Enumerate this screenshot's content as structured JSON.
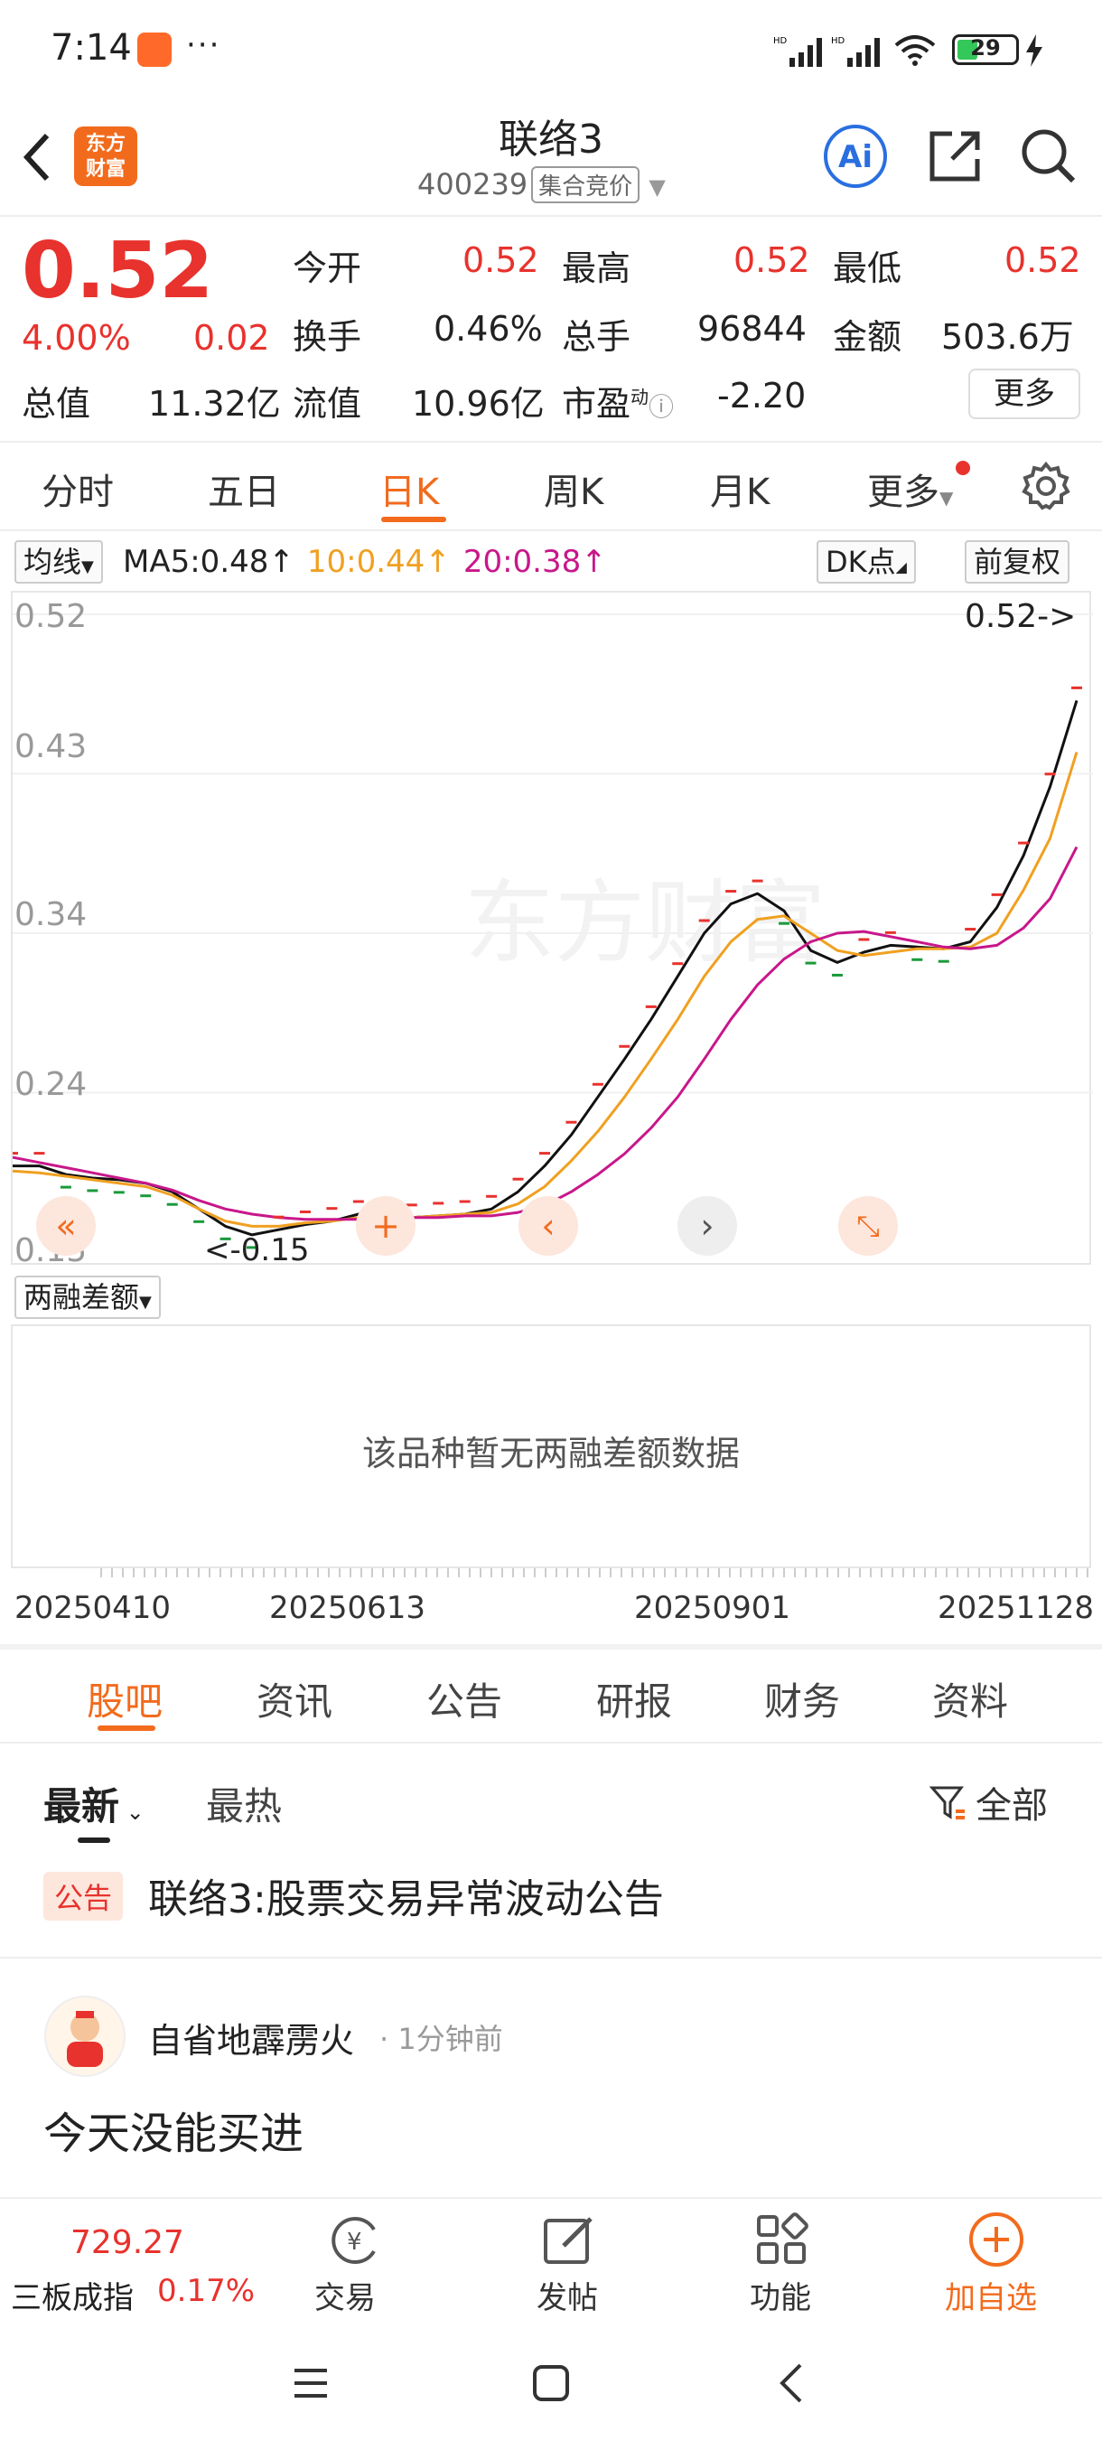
{
  "status": {
    "time": "7:14",
    "battery": "29"
  },
  "header": {
    "back": "‹",
    "logo_line1": "东方",
    "logo_line2": "财富",
    "title": "联络3",
    "code": "400239",
    "badge": "集合竞价"
  },
  "quote": {
    "price": "0.52",
    "change_pct": "4.00%",
    "change": "0.02",
    "open_label": "今开",
    "open": "0.52",
    "high_label": "最高",
    "high": "0.52",
    "low_label": "最低",
    "low": "0.52",
    "turnover_label": "换手",
    "turnover": "0.46%",
    "volume_label": "总手",
    "volume": "96844",
    "amount_label": "金额",
    "amount": "503.6万",
    "mcap_label": "总值",
    "mcap": "11.32亿",
    "float_label": "流值",
    "float": "10.96亿",
    "pe_label": "市盈",
    "pe_sup": "动",
    "pe": "-2.20",
    "more": "更多"
  },
  "period_tabs": [
    "分时",
    "五日",
    "日K",
    "周K",
    "月K",
    "更多"
  ],
  "active_period": 2,
  "ma": {
    "selector": "均线",
    "ma5": "MA5:0.48",
    "ma10": "10:0.44",
    "ma20": "20:0.38",
    "dk": "DK点",
    "adjust": "前复权",
    "ma10_color": "#f0a020",
    "ma20_color": "#c8178a"
  },
  "chart_data": {
    "type": "line",
    "ylim": [
      0.15,
      0.52
    ],
    "yticks": [
      "0.52",
      "0.43",
      "0.34",
      "0.24",
      "0.15"
    ],
    "xticks": [
      "20250410",
      "20250613",
      "20250901",
      "20251128"
    ],
    "max_label": "0.52->",
    "min_label": "<-0.15",
    "series": [
      {
        "name": "MA5",
        "color": "#111111",
        "values": [
          0.2,
          0.2,
          0.195,
          0.193,
          0.192,
          0.19,
          0.185,
          0.175,
          0.165,
          0.16,
          0.163,
          0.166,
          0.168,
          0.172,
          0.17,
          0.17,
          0.171,
          0.172,
          0.175,
          0.185,
          0.2,
          0.218,
          0.24,
          0.262,
          0.285,
          0.31,
          0.335,
          0.352,
          0.358,
          0.348,
          0.325,
          0.318,
          0.324,
          0.328,
          0.327,
          0.326,
          0.33,
          0.35,
          0.38,
          0.42,
          0.47
        ]
      },
      {
        "name": "10",
        "color": "#f0a020",
        "values": [
          0.197,
          0.196,
          0.194,
          0.192,
          0.19,
          0.188,
          0.183,
          0.175,
          0.168,
          0.165,
          0.165,
          0.167,
          0.168,
          0.17,
          0.17,
          0.17,
          0.171,
          0.172,
          0.173,
          0.178,
          0.188,
          0.203,
          0.22,
          0.24,
          0.262,
          0.285,
          0.31,
          0.33,
          0.343,
          0.345,
          0.335,
          0.325,
          0.322,
          0.324,
          0.326,
          0.326,
          0.327,
          0.335,
          0.36,
          0.39,
          0.44
        ]
      },
      {
        "name": "20",
        "color": "#c8178a",
        "values": [
          0.205,
          0.202,
          0.199,
          0.196,
          0.193,
          0.19,
          0.186,
          0.18,
          0.175,
          0.172,
          0.17,
          0.169,
          0.169,
          0.169,
          0.17,
          0.17,
          0.17,
          0.171,
          0.171,
          0.173,
          0.177,
          0.185,
          0.195,
          0.207,
          0.222,
          0.24,
          0.262,
          0.285,
          0.305,
          0.32,
          0.33,
          0.335,
          0.336,
          0.333,
          0.33,
          0.327,
          0.326,
          0.328,
          0.338,
          0.355,
          0.385
        ]
      }
    ]
  },
  "margin": {
    "selector": "两融差额",
    "empty": "该品种暂无两融差额数据"
  },
  "info_tabs": [
    "股吧",
    "资讯",
    "公告",
    "研报",
    "财务",
    "资料"
  ],
  "active_info_tab": 0,
  "feed": {
    "sort_new": "最新",
    "sort_hot": "最热",
    "filter": "全部",
    "notice_tag": "公告",
    "notice_text": "联络3:股票交易异常波动公告",
    "post_user": "自省地霹雳火",
    "post_time": "1分钟前",
    "post_title": "今天没能买进"
  },
  "bottombar": {
    "index_value": "729.27",
    "index_name": "三板成指",
    "index_change": "0.17%",
    "trade": "交易",
    "post": "发帖",
    "func": "功能",
    "add": "加自选"
  }
}
